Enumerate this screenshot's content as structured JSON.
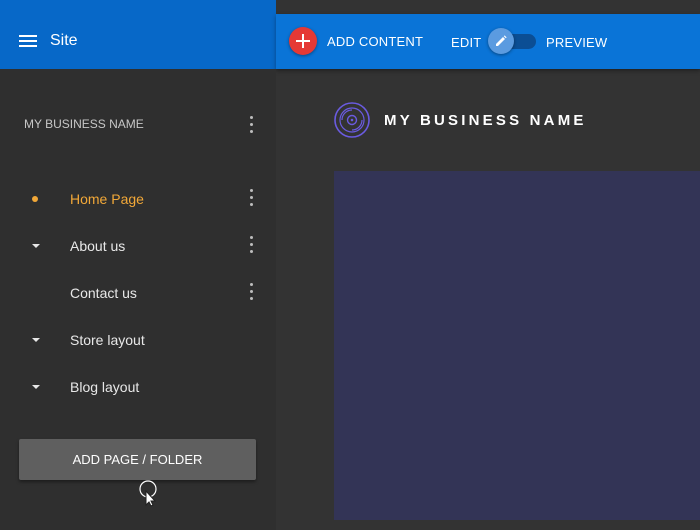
{
  "header": {
    "title": "Site",
    "menu_icon": "hamburger-menu-icon"
  },
  "toolbar": {
    "add_content_label": "ADD CONTENT",
    "edit_label": "EDIT",
    "preview_label": "PREVIEW",
    "mode": "edit",
    "accent_color": "#e53935"
  },
  "sidebar": {
    "site_name": "MY BUSINESS NAME",
    "pages": [
      {
        "label": "Home Page",
        "active": true
      },
      {
        "label": "About us",
        "expandable": true
      },
      {
        "label": "Contact us"
      },
      {
        "label": "Store layout",
        "expandable": true
      },
      {
        "label": "Blog layout",
        "expandable": true
      }
    ],
    "add_button_label": "ADD PAGE / FOLDER"
  },
  "main": {
    "brand_name": "MY BUSINESS NAME",
    "logo_icon": "vinyl-record-icon",
    "content_color": "#333456"
  },
  "colors": {
    "header_blue": "#0768c8",
    "toolbar_blue": "#0a74d7",
    "active_page": "#f2a838",
    "logo_purple": "#6a5be0"
  }
}
